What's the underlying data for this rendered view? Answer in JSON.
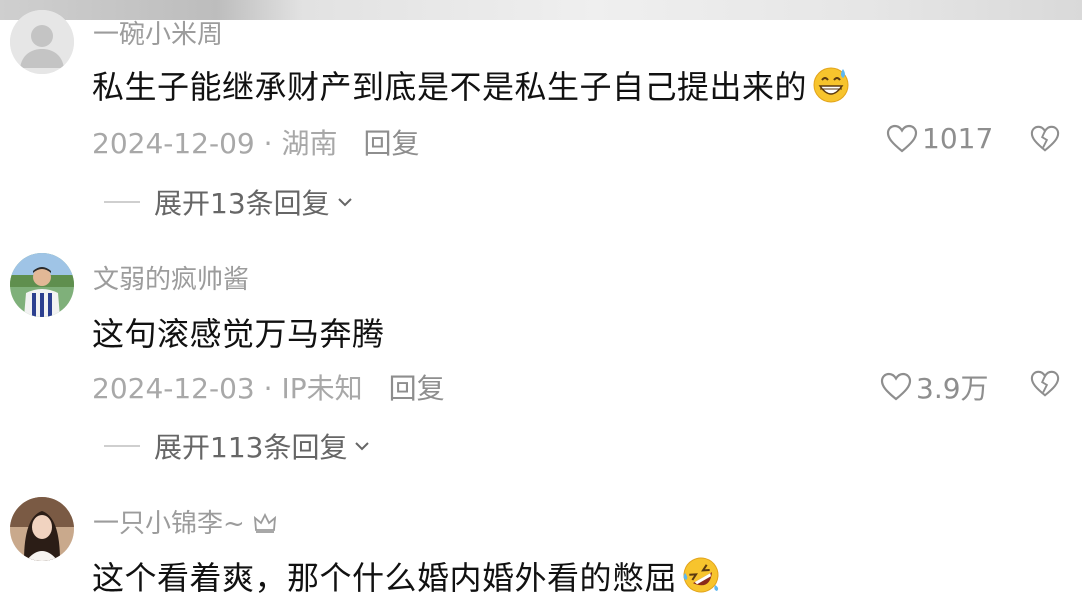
{
  "comments": [
    {
      "username": "一碗小米周",
      "content": "私生子能继承财产到底是不是私生子自己提出来的",
      "date": "2024-12-09",
      "location": "湖南",
      "reply_label": "回复",
      "likes": "1017",
      "expand_label": "展开13条回复",
      "avatar": "default-avatar",
      "emoji": "grinning-sweat-emoji"
    },
    {
      "username": "文弱的疯帅酱",
      "content": "这句滚感觉万马奔腾",
      "date": "2024-12-03",
      "location": "IP未知",
      "reply_label": "回复",
      "likes": "3.9万",
      "expand_label": "展开113条回复",
      "avatar": "photo-avatar"
    },
    {
      "username": "一只小锦李~",
      "badge": "crown-icon",
      "content": "这个看着爽，那个什么婚内婚外看的憋屈",
      "avatar": "photo-avatar",
      "emoji": "rolling-laughing-emoji"
    }
  ],
  "separator": " · ",
  "colors": {
    "username": "#9c9c9c",
    "content": "#111111",
    "meta": "#a8a8a8",
    "expand": "#666666",
    "icon": "#8e8e8e"
  }
}
